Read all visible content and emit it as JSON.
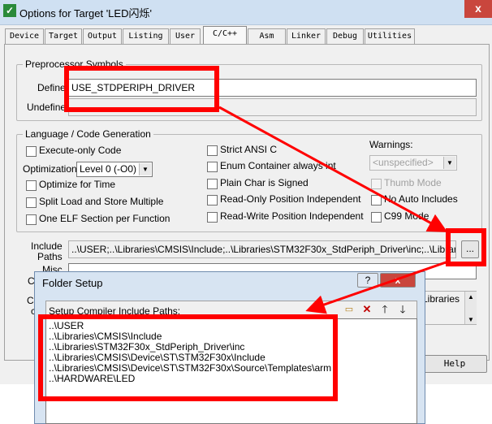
{
  "window": {
    "title": "Options for Target 'LED闪烁'",
    "close_glyph": "x"
  },
  "tabs": [
    {
      "label": "Device"
    },
    {
      "label": "Target"
    },
    {
      "label": "Output"
    },
    {
      "label": "Listing"
    },
    {
      "label": "User"
    },
    {
      "label": "C/C++"
    },
    {
      "label": "Asm"
    },
    {
      "label": "Linker"
    },
    {
      "label": "Debug"
    },
    {
      "label": "Utilities"
    }
  ],
  "preprocessor": {
    "legend": "Preprocessor Symbols",
    "define_label": "Define:",
    "define_value": "USE_STDPERIPH_DRIVER",
    "undefine_label": "Undefine:"
  },
  "language": {
    "legend": "Language / Code Generation",
    "execute_only": "Execute-only Code",
    "optimization_label": "Optimization:",
    "optimization_value": "Level 0 (-O0)",
    "optimize_time": "Optimize for Time",
    "split_load": "Split Load and Store Multiple",
    "one_elf": "One ELF Section per Function",
    "strict_ansi": "Strict ANSI C",
    "enum_container": "Enum Container always int",
    "plain_char": "Plain Char is Signed",
    "ro_pos": "Read-Only Position Independent",
    "rw_pos": "Read-Write Position Independent",
    "warnings_label": "Warnings:",
    "warnings_value": "<unspecified>",
    "thumb_mode": "Thumb Mode",
    "no_auto": "No Auto Includes",
    "c99": "C99 Mode"
  },
  "include": {
    "label_line1": "Include",
    "label_line2": "Paths",
    "value": "..\\USER;..\\Libraries\\CMSIS\\Include;..\\Libraries\\STM32F30x_StdPeriph_Driver\\inc;..\\Libraries\\CMSIS",
    "browse": "...",
    "misc_label": "Misc",
    "compiler_label_1": "C",
    "compiler_label_2": "Co",
    "compiler_label_3": "c",
    "libraries_tail": "Libraries"
  },
  "help_button": "Help",
  "folder_dialog": {
    "title": "Folder Setup",
    "help_glyph": "?",
    "close_glyph": "x",
    "header": "Setup Compiler Include Paths:",
    "paths": [
      "..\\USER",
      "..\\Libraries\\CMSIS\\Include",
      "..\\Libraries\\STM32F30x_StdPeriph_Driver\\inc",
      "..\\Libraries\\CMSIS\\Device\\ST\\STM32F30x\\Include",
      "..\\Libraries\\CMSIS\\Device\\ST\\STM32F30x\\Source\\Templates\\arm",
      "..\\HARDWARE\\LED"
    ],
    "toolbar_icons": [
      "new-folder-icon",
      "delete-icon",
      "move-up-icon",
      "move-down-icon"
    ]
  },
  "colors": {
    "annotation": "#ff0000",
    "title_bar": "#cfe0f2",
    "close": "#c9463d"
  }
}
